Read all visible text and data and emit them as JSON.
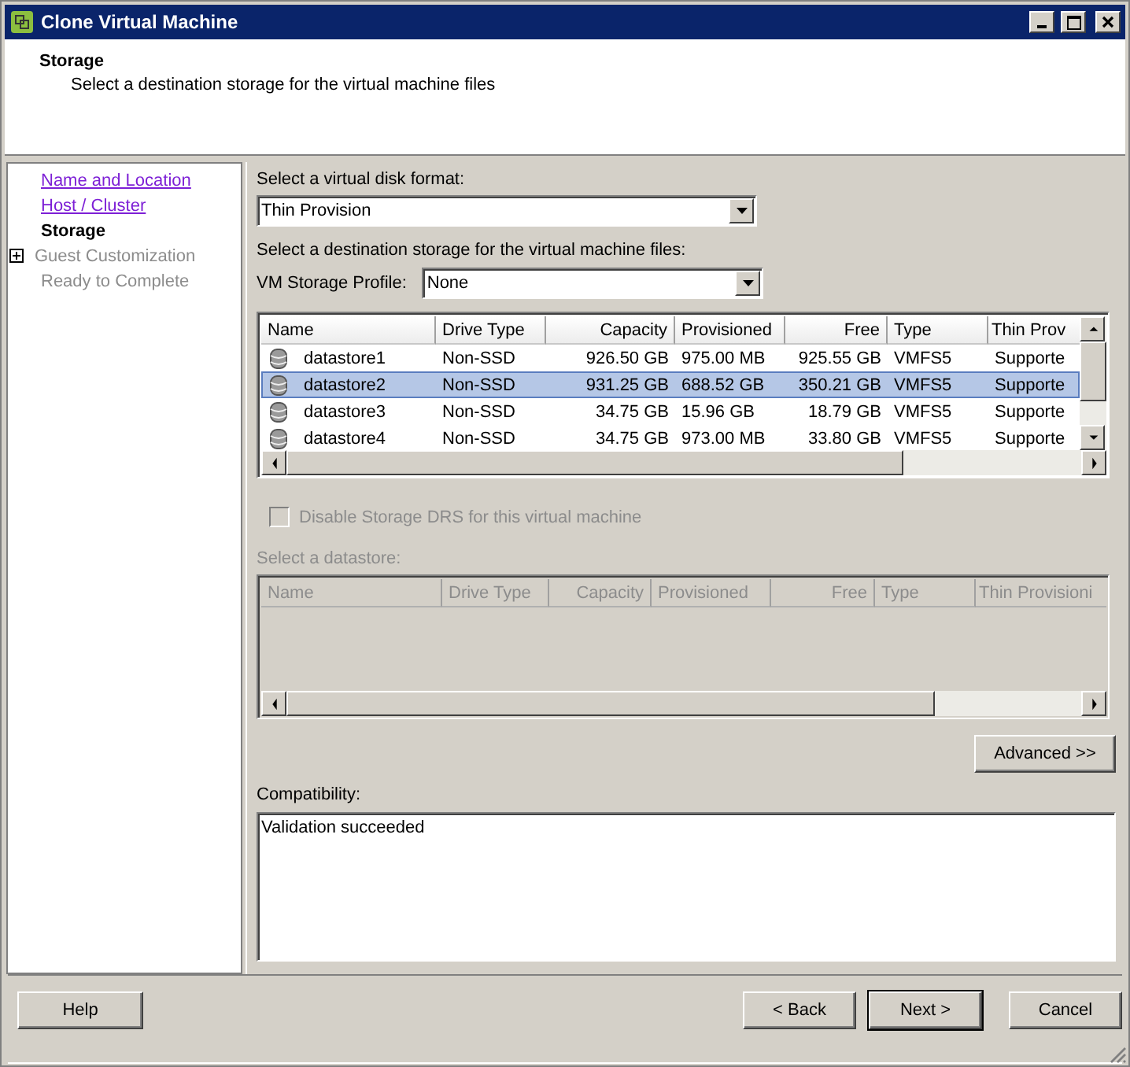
{
  "window": {
    "title": "Clone Virtual Machine"
  },
  "header": {
    "title": "Storage",
    "subtitle": "Select a destination storage for the virtual machine files"
  },
  "steps": [
    {
      "label": "Name and Location",
      "kind": "link"
    },
    {
      "label": "Host / Cluster",
      "kind": "link"
    },
    {
      "label": "Storage",
      "kind": "current"
    },
    {
      "label": "Guest Customization",
      "kind": "disabled",
      "expanded": false
    },
    {
      "label": "Ready to Complete",
      "kind": "disabled"
    }
  ],
  "disk_format": {
    "label": "Select a virtual disk format:",
    "value": "Thin Provision"
  },
  "destination_label": "Select a destination storage for the virtual machine files:",
  "storage_profile": {
    "label": "VM Storage Profile:",
    "value": "None"
  },
  "datastores": {
    "columns": [
      "Name",
      "Drive Type",
      "Capacity",
      "Provisioned",
      "Free",
      "Type",
      "Thin Prov"
    ],
    "rows": [
      {
        "cells": [
          "datastore1",
          "Non-SSD",
          "926.50 GB",
          "975.00 MB",
          "925.55 GB",
          "VMFS5",
          "Supporte"
        ],
        "selected": false
      },
      {
        "cells": [
          "datastore2",
          "Non-SSD",
          "931.25 GB",
          "688.52 GB",
          "350.21 GB",
          "VMFS5",
          "Supporte"
        ],
        "selected": true
      },
      {
        "cells": [
          "datastore3",
          "Non-SSD",
          "34.75 GB",
          "15.96 GB",
          "18.79 GB",
          "VMFS5",
          "Supporte"
        ],
        "selected": false
      },
      {
        "cells": [
          "datastore4",
          "Non-SSD",
          "34.75 GB",
          "973.00 MB",
          "33.80 GB",
          "VMFS5",
          "Supporte"
        ],
        "selected": false
      }
    ]
  },
  "disable_drs": {
    "label": "Disable Storage DRS for this virtual machine",
    "checked": false,
    "disabled": true
  },
  "datastore_picker": {
    "label": "Select a datastore:",
    "disabled": true,
    "columns": [
      "Name",
      "Drive Type",
      "Capacity",
      "Provisioned",
      "Free",
      "Type",
      "Thin Provisioni"
    ]
  },
  "advanced_button": "Advanced >>",
  "compatibility": {
    "label": "Compatibility:",
    "text": "Validation succeeded"
  },
  "help_button": "Help",
  "buttons": [
    {
      "label": "< Back",
      "default": false
    },
    {
      "label": "Next >",
      "default": true
    },
    {
      "label": "Cancel",
      "default": false
    }
  ]
}
